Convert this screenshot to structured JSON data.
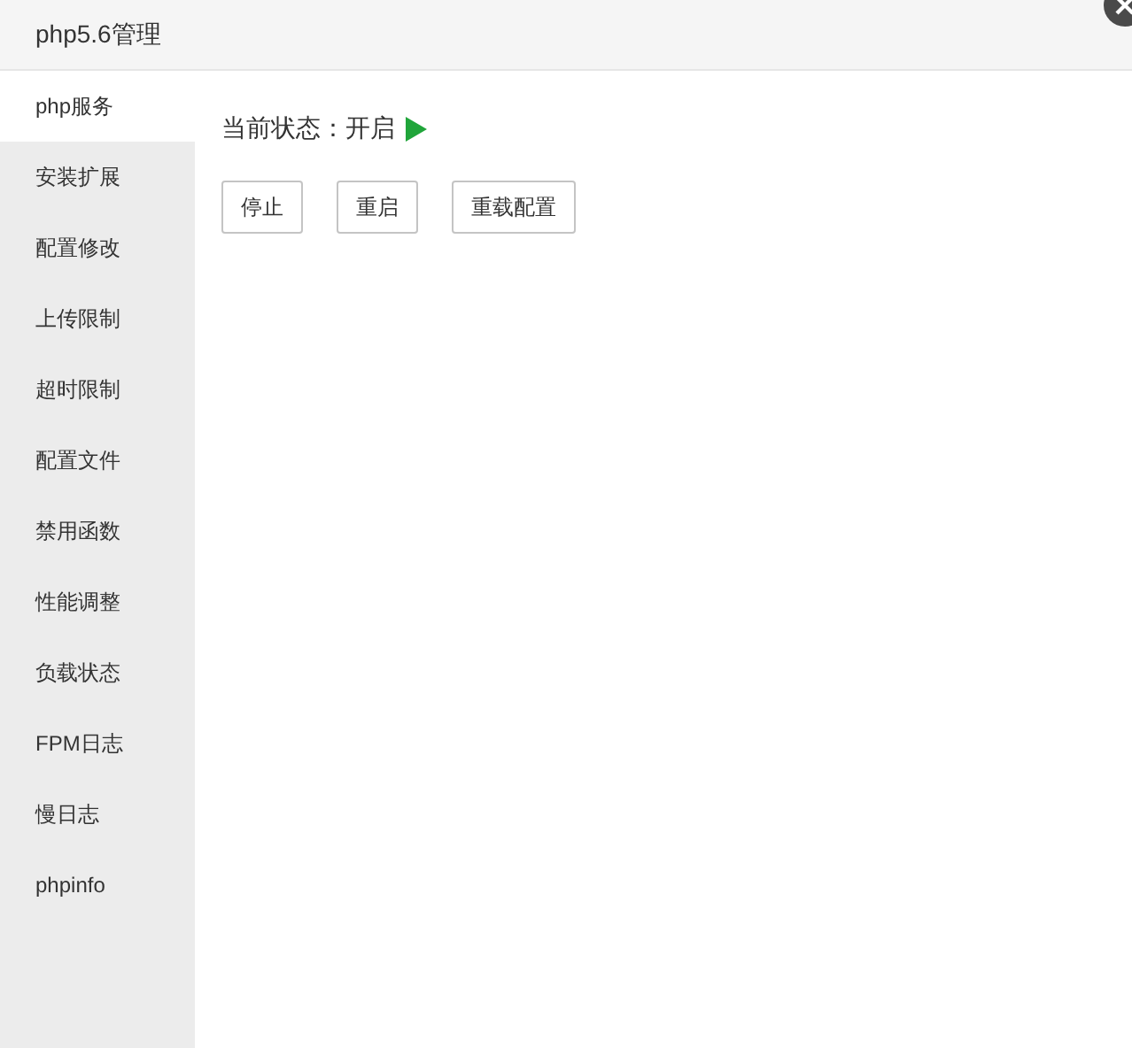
{
  "window": {
    "title": "php5.6管理"
  },
  "sidebar": {
    "items": [
      {
        "label": "php服务",
        "selected": true
      },
      {
        "label": "安装扩展",
        "selected": false
      },
      {
        "label": "配置修改",
        "selected": false
      },
      {
        "label": "上传限制",
        "selected": false
      },
      {
        "label": "超时限制",
        "selected": false
      },
      {
        "label": "配置文件",
        "selected": false
      },
      {
        "label": "禁用函数",
        "selected": false
      },
      {
        "label": "性能调整",
        "selected": false
      },
      {
        "label": "负载状态",
        "selected": false
      },
      {
        "label": "FPM日志",
        "selected": false
      },
      {
        "label": "慢日志",
        "selected": false
      },
      {
        "label": "phpinfo",
        "selected": false
      }
    ]
  },
  "status": {
    "label": "当前状态：",
    "value": "开启",
    "running": true
  },
  "buttons": [
    "停止",
    "重启",
    "重载配置"
  ]
}
